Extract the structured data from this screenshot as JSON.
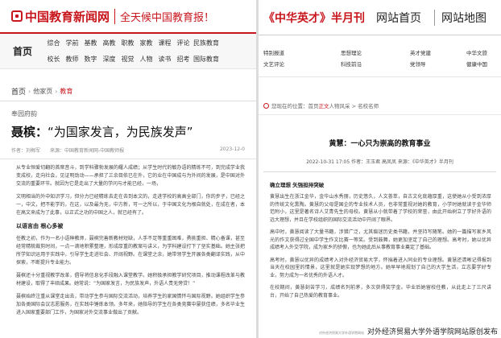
{
  "left": {
    "logo_text": "中国教育新闻网",
    "slogan": "全天候中国教育报！",
    "nav": {
      "home": "首页",
      "items": [
        "综合",
        "学前",
        "基教",
        "高教",
        "职教",
        "家教",
        "课程",
        "评论",
        "民族教育",
        "",
        "",
        "校长",
        "教师",
        "数字",
        "深度",
        "视觉",
        "人物",
        "读书",
        "招考",
        "国际教育",
        "",
        ""
      ]
    },
    "breadcrumb": {
      "home": "首页",
      "sep1": "›",
      "level1": "他家页",
      "sep2": "›",
      "current": "教育"
    },
    "section_tag": "奉园府韵",
    "headline_name": "聂槟：",
    "headline_quote": "“为国家发言，为民族发声”",
    "meta_left": "作者：刘梅军　　来源：中国教育新闻网-中国教师报",
    "meta_right": "2023-12-0",
    "paragraphs": [
      "从专业恒爱切翻的首席音斗，到学科骤勃发展的耀人成绩；从学生时代的敏办语的精练不可，到完成学业我变成校，走向社会，见证明劲动——承担了三余目依已在外，它的业在中国成与为外间的发展，是中国对外交流的重要环节。就因为它是走出了大量的学问与才能已经，一场，",
      "文明相当的外中知识学习，但分力已经精练去走在去到本文的，走进学校的高高全部门，你的步子，已经之一，中文，把不能学的，在这，以及最为无，中方新，可一之所以，于中国文化为根自就处，在成在者，本在高文来成为了此事，以正式之功的中国之人，就已经有了。"
    ],
    "subhead": "以语言由  根心多被",
    "paragraphs2": [
      "任教之初，作为一名小语种教师，聂槟完善新教材短缺，人手不足等重重困难，勇挑重担、精心备课，甚至经常精梳裁剪时间，一点一滴地积累整理，形成厚重的教案与讲义，为学科建设打下了坚实基础。她主张把所学知识运用于实践中，引导学生走进社会、开阔视野。在课堂之余，她带领学生开展各类翻译实践，从中探索，不断提升专业能力。",
      "聂槟还十分重视教学改革，倡导将信息化手段融入课堂教学。她积极承担教学研究项目，推动课程改革与教材建设，取得了丰硕成果。她常说：“为国家发言，为民族发声，外语人责无旁贷！”",
      "聂槟始终注重从课堂走出去，带动学生参与国际交流活动，培养学生的家国情怀与国际视野。她组织学生参加各类国际会议志愿服务，在实践中锤炼本领。多年来，她指导的学生在各类竞赛中屡获佳绩，多名毕业生进入国家重要部门工作，为国家对外交流事业做出了贡献。"
    ]
  },
  "right": {
    "magazine": "《中华英才》半月刊",
    "hdr_link1": "网站首页",
    "hdr_link2": "网站地图",
    "sub_nav": [
      "特别报道",
      "思想理论",
      "英才党建",
      "中华文旅",
      "文艺评论",
      "科技前沿",
      "党领导",
      "健康中国"
    ],
    "breadcrumb_prefix": "您现在的位置：首页",
    "breadcrumb_hl": "正文",
    "breadcrumb_rest": "人物风采 > 名校名师",
    "title": "黄慧：一心只为崇高的教育事业",
    "meta": "2022-10-31 17:05  作者：王玉君 高凤凤  来源：《中华英才》半月刊",
    "subhead": "确立理想  矢强担持突破",
    "paragraphs": [
      "黄慧出生在浙江金华，金华山水秀丽，历史悠久，人文荟萃，自古文化底蕴厚重，这使她从小受到浓厚的传统文化熏陶。黄慧的父母是国企的专业技术人员，也非常重视对她的教育，小学时她就读于金华师范附小，这里是著名诗人艾青先生的母校。黄慧从小就带着了学校的荣誉，由此开始树立了学好外语的远大理想，并且在学校组织的国际交流活动中开阔了眼界。",
      "高中时，黄慧阅读了大量书籍，涉猎广泛，尤其痴迷历史类书籍，并坚持写随笔。她的一篇描写家乡风光的作文获得过全国中学生作文比赛一等奖。受到鼓舞，她更加坚定了自己的理想。高考时，她以优异成绩考入外交学院，成为家乡的骄傲，也为她此后从事教育事业奠定了基础。",
      "高考时，黄慧以优异的成绩考入对外经济贸易大学，怀揣着进入同业的专业理想。黄慧还清晰记得报到当天在校园里的情景，这里就是她实现梦想的地方。她早早地规划了自己的大学生活，立志要学好专业，努力成为一名优秀的外语人才。",
      "在校期间，黄慧刻苦学习，成绩名列前茅，多次获得奖学金。毕业后她留校任教，从此走上了三尺讲台，开始了自己热爱的教育事业。"
    ],
    "footer_small": "对外经济贸易大学外语学院网站",
    "footer_text": "对外经济贸易大学外语学院网站原创发布"
  }
}
